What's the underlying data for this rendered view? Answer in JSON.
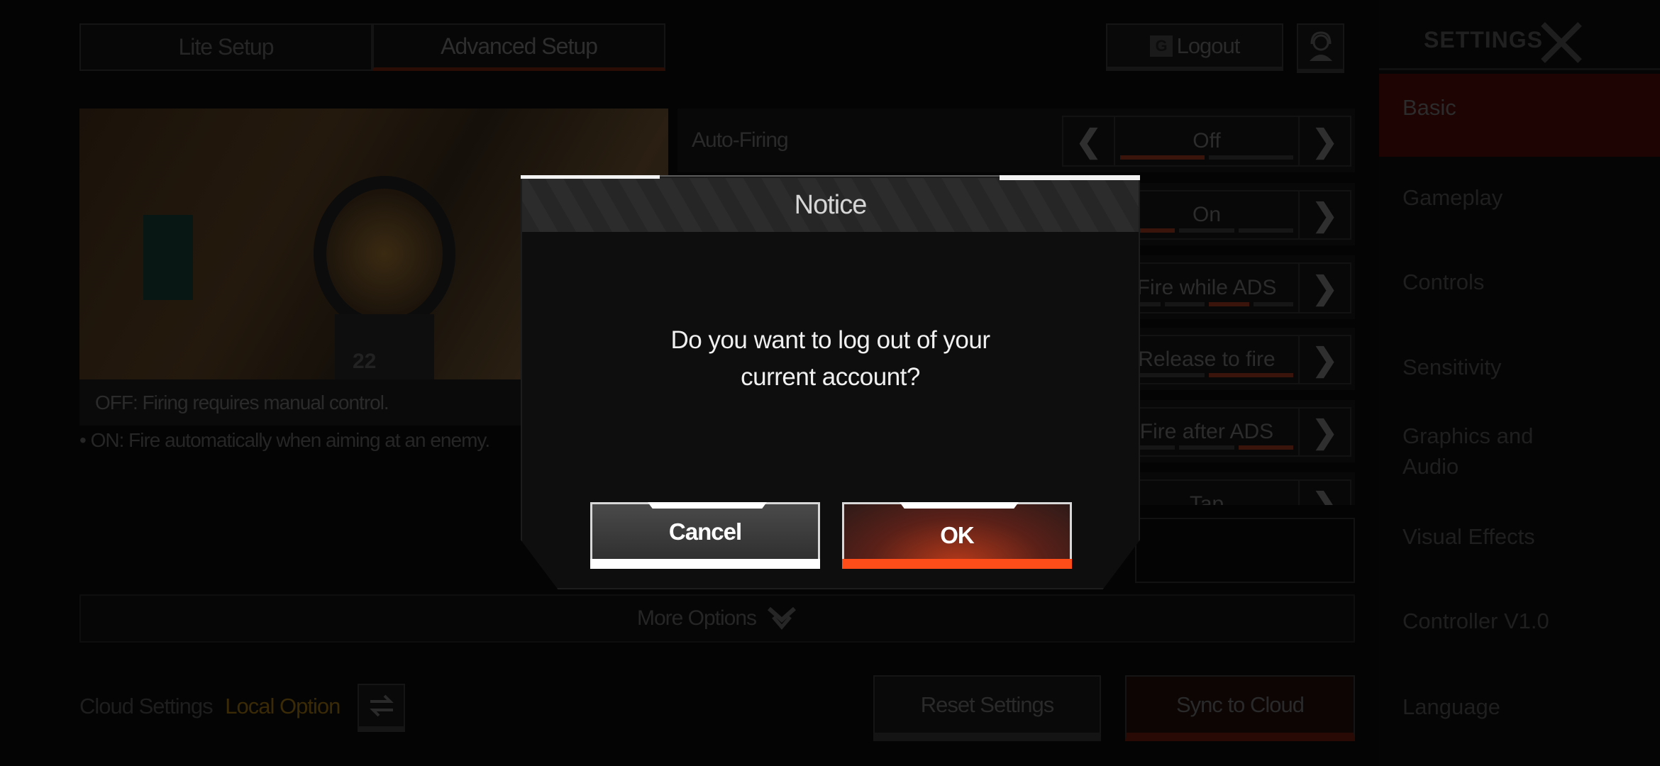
{
  "tabs": [
    {
      "label": "Lite Setup",
      "active": false
    },
    {
      "label": "Advanced Setup",
      "active": true
    }
  ],
  "header": {
    "logout_label": "Logout",
    "support_icon": "headset-agent-icon",
    "google_icon": "google-g-icon"
  },
  "preview": {
    "caption": "OFF: Firing requires manual control.",
    "note": "• ON: Fire automatically when aiming at an enemy.",
    "hud_number": "22"
  },
  "settings_rows": [
    {
      "label": "Auto-Firing",
      "value": "Off",
      "segments": 2,
      "selected": 0
    },
    {
      "label": "",
      "value": "On",
      "segments": 3,
      "selected": 0
    },
    {
      "label": "",
      "value": "Fire while ADS",
      "segments": 4,
      "selected": 2
    },
    {
      "label": "",
      "value": "Release to fire",
      "segments": 2,
      "selected": 1
    },
    {
      "label": "",
      "value": "Fire after ADS",
      "segments": 3,
      "selected": 2
    },
    {
      "label": "",
      "value": "Tap",
      "segments": 2,
      "selected": 0
    }
  ],
  "more_options": "More Options",
  "cloud": {
    "label": "Cloud Settings",
    "value": "Local Option"
  },
  "buttons": {
    "reset": "Reset Settings",
    "sync": "Sync to Cloud"
  },
  "sidebar": {
    "title": "SETTINGS",
    "items": [
      {
        "label": "Basic",
        "active": true
      },
      {
        "label": "Gameplay"
      },
      {
        "label": "Controls"
      },
      {
        "label": "Sensitivity"
      },
      {
        "label": "Graphics and Audio"
      },
      {
        "label": "Visual Effects"
      },
      {
        "label": "Controller V1.0"
      },
      {
        "label": "Language"
      }
    ]
  },
  "dialog": {
    "title": "Notice",
    "message": "Do you want to log out of your current account?",
    "cancel": "Cancel",
    "ok": "OK"
  },
  "colors": {
    "accent": "#ff4d1a",
    "local_option": "#3a2a06",
    "active_sidebar": "#1e0403"
  }
}
